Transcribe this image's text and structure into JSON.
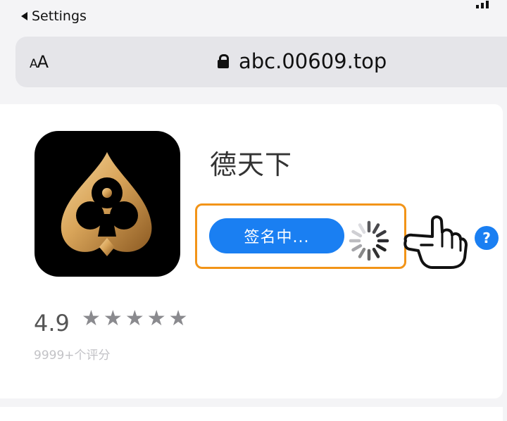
{
  "status_bar": {
    "back_label": "Settings"
  },
  "address_bar": {
    "text_size_label_small": "A",
    "text_size_label_large": "A",
    "url": "abc.00609.top"
  },
  "app": {
    "name": "德天下",
    "sign_button_label": "签名中...",
    "help_label": "?",
    "rating": "4.9",
    "stars": [
      "★",
      "★",
      "★",
      "★",
      "★"
    ],
    "rating_count": "9999+个评分"
  },
  "colors": {
    "accent": "#1a7ff2",
    "highlight": "#f29418",
    "icon_background": "#000000",
    "icon_gold": "#d9a55a"
  },
  "icons": {
    "back": "back-triangle-icon",
    "lock": "lock-icon",
    "spinner": "loading-spinner-icon",
    "pointer": "pointing-hand-icon",
    "help": "help-icon",
    "app": "spade-logo-icon"
  }
}
